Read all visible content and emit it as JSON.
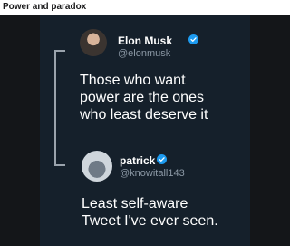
{
  "post": {
    "title": "Power and paradox"
  },
  "tweets": [
    {
      "name": "Elon Musk",
      "handle": "@elonmusk",
      "text_lines": [
        "Those who want",
        "power are the ones",
        "who least deserve it"
      ]
    },
    {
      "name": "patrick",
      "handle": "@knowitall143",
      "text_lines": [
        "Least self-aware",
        "Tweet I've ever seen."
      ]
    }
  ],
  "icons": {
    "verified": "verified-badge-icon"
  },
  "colors": {
    "tweet_bg": "#15202b",
    "verified": "#1d9bf0",
    "handle": "#8b98a5"
  }
}
